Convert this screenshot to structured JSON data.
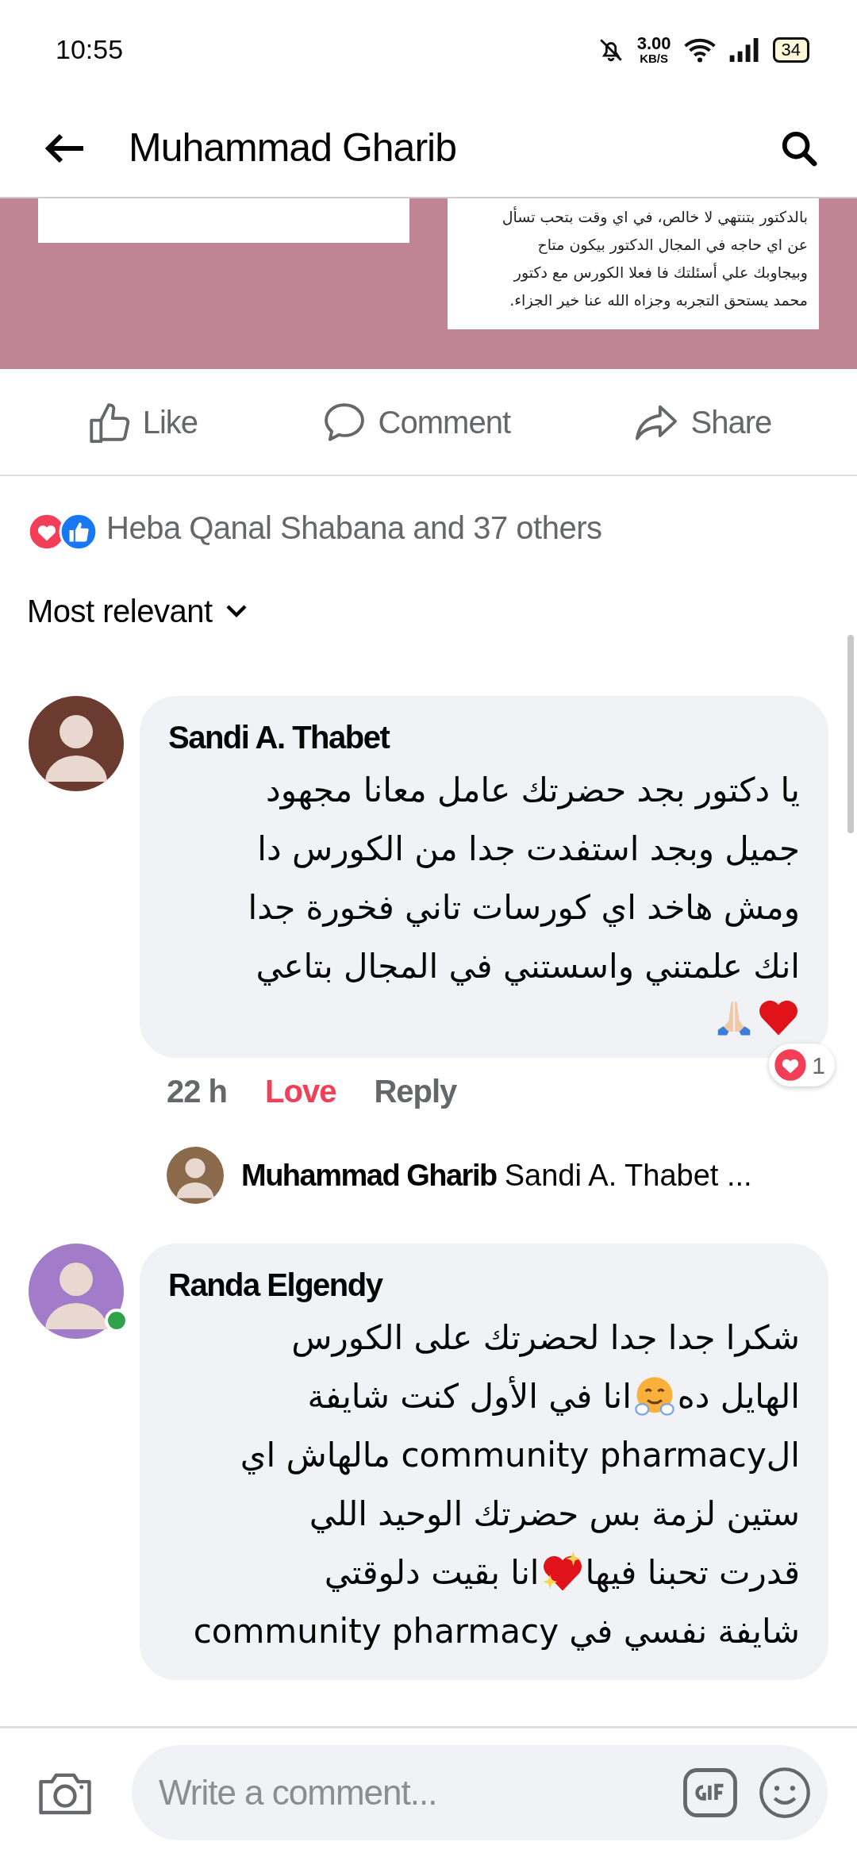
{
  "status_bar": {
    "time": "10:55",
    "net_speed": "3.00",
    "net_unit": "KB/S",
    "battery": "34"
  },
  "header": {
    "title": "Muhammad Gharib"
  },
  "post_image": {
    "text_lines": [
      "بالدكتور بتنتهي لا خالص،  في اي وقت بتحب تسأل",
      "عن اي حاجه في المجال الدكتور بيكون متاح",
      "وبيجاوبك علي أسئلتك فا فعلا الكورس مع دكتور",
      "محمد يستحق التجربه وجزاه الله عنا خير الجزاء."
    ]
  },
  "actions": {
    "like": {
      "label": "Like"
    },
    "comment": {
      "label": "Comment"
    },
    "share": {
      "label": "Share"
    }
  },
  "reactions": {
    "summary": "Heba Qanal Shabana and 37 others"
  },
  "sort": {
    "label": "Most relevant"
  },
  "comments": [
    {
      "author": "Sandi A. Thabet",
      "online": false,
      "lines": [
        [
          {
            "kind": "text",
            "text": "يا دكتور بجد حضرتك عامل معانا مجهود"
          }
        ],
        [
          {
            "kind": "text",
            "text": "جميل وبجد استفدت جدا من الكورس دا"
          }
        ],
        [
          {
            "kind": "text",
            "text": "ومش هاخد اي كورسات تاني فخورة جدا"
          }
        ],
        [
          {
            "kind": "text",
            "text": "انك علمتني واسستني في المجال بتاعي"
          }
        ],
        [
          {
            "kind": "heart"
          },
          {
            "kind": "pray"
          }
        ]
      ],
      "time": "22 h",
      "reaction_label": "Love",
      "reacted": true,
      "reply_label": "Reply",
      "reaction_count": "1",
      "replies": [
        {
          "author": "Muhammad Gharib",
          "preview": "Sandi A. Thabet ..."
        }
      ]
    },
    {
      "author": "Randa Elgendy",
      "online": true,
      "lines": [
        [
          {
            "kind": "text",
            "text": "شكرا جدا جدا لحضرتك على الكورس"
          }
        ],
        [
          {
            "kind": "text",
            "text": "الهايل ده"
          },
          {
            "kind": "hug"
          },
          {
            "kind": "text",
            "text": "انا في الأول كنت شايفة"
          }
        ],
        [
          {
            "kind": "text",
            "text": "الcommunity pharmacy مالهاش اي"
          }
        ],
        [
          {
            "kind": "text",
            "text": "ستين لزمة بس حضرتك الوحيد اللي"
          }
        ],
        [
          {
            "kind": "text",
            "text": "قدرت تحبنا فيها"
          },
          {
            "kind": "sparkle-heart"
          },
          {
            "kind": "text",
            "text": "انا بقيت دلوقتي"
          }
        ],
        [
          {
            "kind": "text",
            "text": "شايفة نفسي في community pharmacy"
          }
        ]
      ]
    }
  ],
  "composer": {
    "placeholder": "Write a comment..."
  }
}
